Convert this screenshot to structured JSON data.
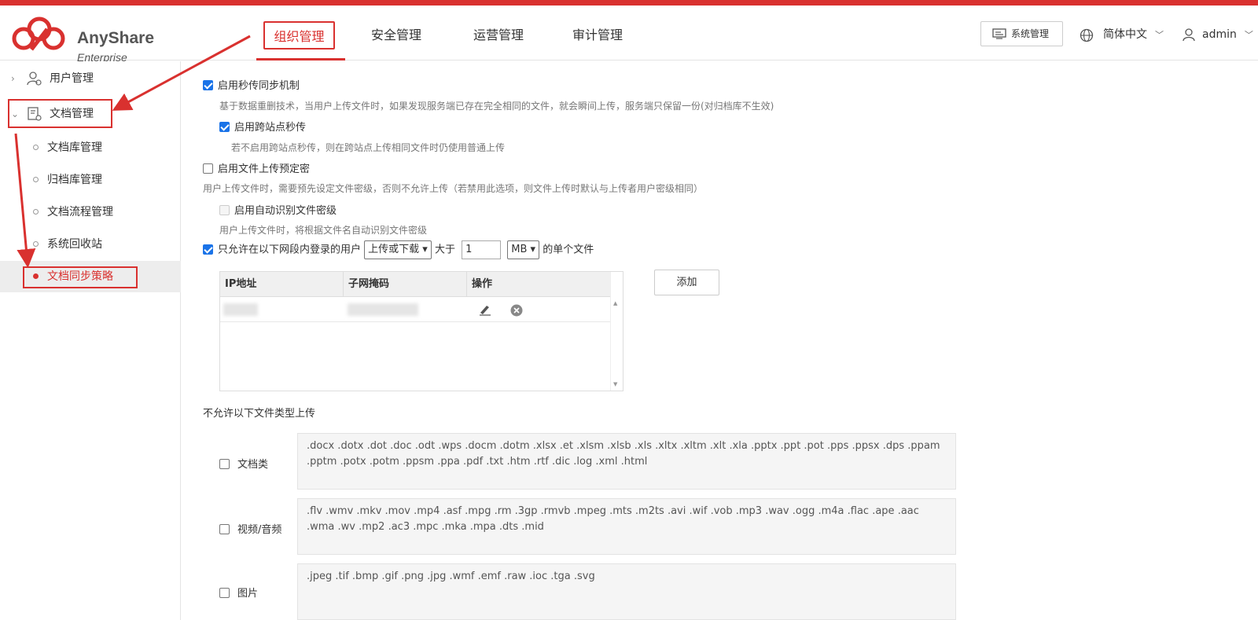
{
  "header": {
    "brand": "AnyShare",
    "brand_sub": "Enterprise",
    "tabs": [
      "组织管理",
      "安全管理",
      "运营管理",
      "审计管理"
    ],
    "system_button": "系统管理",
    "language": "简体中文",
    "user": "admin",
    "accent": "#d9312f"
  },
  "sidebar": {
    "groups": [
      {
        "label": "用户管理",
        "icon": "user-settings-icon"
      },
      {
        "label": "文档管理",
        "icon": "document-settings-icon"
      }
    ],
    "items": [
      "文档库管理",
      "归档库管理",
      "文档流程管理",
      "系统回收站",
      "文档同步策略"
    ],
    "active_item": "文档同步策略"
  },
  "main": {
    "instant_upload": {
      "label": "启用秒传同步机制",
      "checked": true,
      "desc": "基于数据重删技术，当用户上传文件时，如果发现服务端已存在完全相同的文件，就会瞬间上传，服务端只保留一份(对归档库不生效)"
    },
    "cross_site": {
      "label": "启用跨站点秒传",
      "checked": true,
      "desc": "若不启用跨站点秒传，则在跨站点上传相同文件时仍使用普通上传"
    },
    "preset_secret": {
      "label": "启用文件上传预定密",
      "checked": false,
      "desc": "用户上传文件时，需要预先设定文件密级，否则不允许上传（若禁用此选项，则文件上传时默认与上传者用户密级相同）"
    },
    "auto_secret": {
      "label": "启用自动识别文件密级",
      "checked": false,
      "desc": "用户上传文件时，将根据文件名自动识别文件密级"
    },
    "network_limit": {
      "checked": true,
      "prefix": "只允许在以下网段内登录的用户",
      "mode": "上传或下载",
      "mid": "大于",
      "size": "1",
      "unit": "MB",
      "suffix": "的单个文件"
    },
    "table": {
      "headers": [
        "IP地址",
        "子网掩码",
        "操作"
      ]
    },
    "add_button": "添加",
    "forbidden_title": "不允许以下文件类型上传",
    "file_types": [
      {
        "label": "文档类",
        "checked": false,
        "exts": ".docx .dotx .dot .doc .odt .wps .docm .dotm .xlsx .et .xlsm .xlsb .xls .xltx .xltm .xlt .xla .pptx .ppt .pot .pps .ppsx .dps .ppam .pptm .potx .potm .ppsm .ppa .pdf .txt .htm .rtf .dic .log .xml .html"
      },
      {
        "label": "视频/音频",
        "checked": false,
        "exts": ".flv .wmv .mkv .mov .mp4 .asf .mpg .rm .3gp .rmvb .mpeg .mts .m2ts .avi .wif .vob .mp3 .wav .ogg .m4a .flac .ape .aac .wma .wv .mp2 .ac3 .mpc .mka .mpa .dts .mid"
      },
      {
        "label": "图片",
        "checked": false,
        "exts": ".jpeg .tif .bmp .gif .png .jpg .wmf .emf .raw .ioc .tga .svg"
      }
    ]
  }
}
